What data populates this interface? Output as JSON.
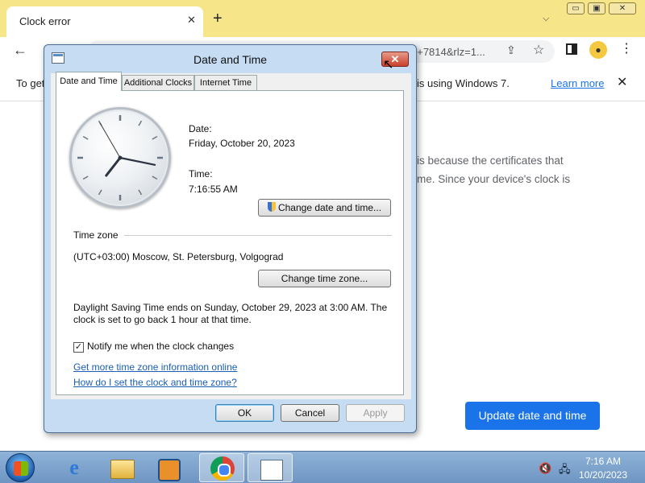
{
  "browser": {
    "tab_title": "Clock error",
    "tab_close": "✕",
    "new_tab": "+",
    "tab_list": "⌵",
    "url_fragment": "8+7814&rlz=1...",
    "window_buttons": [
      "▭",
      "▣",
      "✕"
    ]
  },
  "infobar": {
    "text_left": "To get",
    "text_right": "is using Windows 7.",
    "learn_more": "Learn more",
    "close": "✕"
  },
  "page": {
    "error_line1": "is because the certificates that",
    "error_line2": "me. Since your device's clock is",
    "update_button": "Update date and time"
  },
  "dialog": {
    "title": "Date and Time",
    "close": "✕",
    "tabs": [
      "Date and Time",
      "Additional Clocks",
      "Internet Time"
    ],
    "date_label": "Date:",
    "date_value": "Friday, October 20, 2023",
    "time_label": "Time:",
    "time_value": "7:16:55 AM",
    "clock_time": {
      "hour": 7,
      "minute": 16,
      "second": 55
    },
    "change_datetime_button": "Change date and time...",
    "timezone_label": "Time zone",
    "timezone_value": "(UTC+03:00) Moscow, St. Petersburg, Volgograd",
    "change_timezone_button": "Change time zone...",
    "dst_line1": "Daylight Saving Time ends on Sunday, October 29, 2023 at 3:00 AM. The",
    "dst_line2": "clock is set to go back 1 hour at that time.",
    "notify_checked": true,
    "notify_label": "Notify me when the clock changes",
    "link_tz_online": "Get more time zone information online",
    "link_how_set": "How do I set the clock and time zone?",
    "ok_button": "OK",
    "cancel_button": "Cancel",
    "apply_button": "Apply"
  },
  "taskbar": {
    "time": "7:16 AM",
    "date": "10/20/2023",
    "ie_glyph": "e",
    "icons": [
      "start-orb-icon",
      "internet-explorer-icon",
      "file-explorer-icon",
      "media-player-icon",
      "chrome-icon",
      "date-time-icon",
      "volume-muted-icon",
      "network-icon"
    ]
  },
  "colors": {
    "chrome_frame": "#f7e58a",
    "accent_blue": "#1a73e8",
    "dialog_frame": "#c5dcf3",
    "taskbar": "#7ea4cd"
  }
}
